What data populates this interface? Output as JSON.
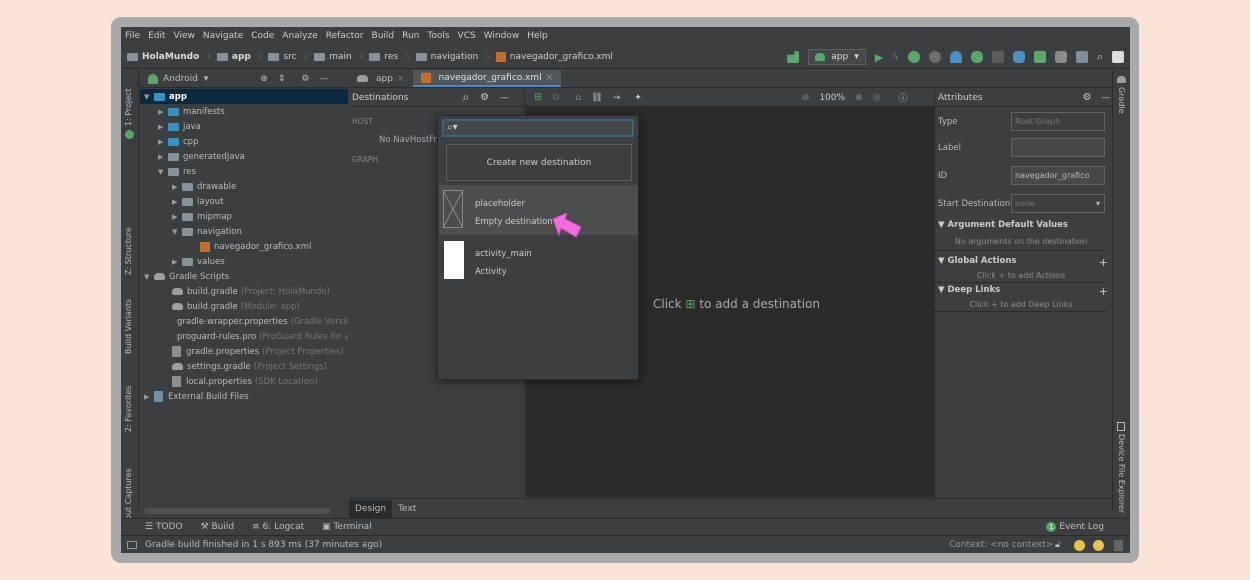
{
  "menu": [
    "File",
    "Edit",
    "View",
    "Navigate",
    "Code",
    "Analyze",
    "Refactor",
    "Build",
    "Run",
    "Tools",
    "VCS",
    "Window",
    "Help"
  ],
  "breadcrumb": [
    "HolaMundo",
    "app",
    "src",
    "main",
    "res",
    "navigation",
    "navegador_grafico.xml"
  ],
  "run_config": "app",
  "project_view": "Android",
  "tree": [
    {
      "label": "app",
      "note": ""
    },
    {
      "label": "manifests",
      "note": ""
    },
    {
      "label": "java",
      "note": ""
    },
    {
      "label": "cpp",
      "note": ""
    },
    {
      "label": "generatedJava",
      "note": ""
    },
    {
      "label": "res",
      "note": ""
    },
    {
      "label": "drawable",
      "note": ""
    },
    {
      "label": "layout",
      "note": ""
    },
    {
      "label": "mipmap",
      "note": ""
    },
    {
      "label": "navigation",
      "note": ""
    },
    {
      "label": "navegador_grafico.xml",
      "note": ""
    },
    {
      "label": "values",
      "note": ""
    },
    {
      "label": "Gradle Scripts",
      "note": ""
    },
    {
      "label": "build.gradle",
      "note": "(Project: HolaMundo)"
    },
    {
      "label": "build.gradle",
      "note": "(Module: app)"
    },
    {
      "label": "gradle-wrapper.properties",
      "note": "(Gradle Version"
    },
    {
      "label": "proguard-rules.pro",
      "note": "(ProGuard Rules for ap"
    },
    {
      "label": "gradle.properties",
      "note": "(Project Properties)"
    },
    {
      "label": "settings.gradle",
      "note": "(Project Settings)"
    },
    {
      "label": "local.properties",
      "note": "(SDK Location)"
    },
    {
      "label": "External Build Files",
      "note": ""
    }
  ],
  "left_strip": [
    "1: Project",
    "Z: Structure",
    "Build Variants",
    "2: Favorites",
    "Layout Captures"
  ],
  "right_strip": [
    "Gradle",
    "Device File Explorer"
  ],
  "tabs": [
    "app",
    "navegador_grafico.xml"
  ],
  "destinations": {
    "title": "Destinations",
    "host_label": "HOST",
    "host_value": "No NavHostFr",
    "graph_label": "GRAPH"
  },
  "popup": {
    "create_label": "Create new destination",
    "items": [
      {
        "name": "placeholder",
        "sub": "Empty destination"
      },
      {
        "name": "activity_main",
        "sub": "Activity"
      }
    ]
  },
  "zoom": "100%",
  "canvas": {
    "hint_before": "Click",
    "hint_after": "to add a destination"
  },
  "attributes": {
    "title": "Attributes",
    "type_label": "Type",
    "type_value": "Root Graph",
    "label_label": "Label",
    "label_value": "",
    "id_label": "ID",
    "id_value": "navegador_grafico",
    "start_label": "Start Destination",
    "start_value": "none",
    "arg_title": "Argument Default Values",
    "arg_sub": "No arguments on the destination",
    "actions_title": "Global Actions",
    "actions_sub": "Click + to add Actions",
    "links_title": "Deep Links",
    "links_sub": "Click + to add Deep Links"
  },
  "design_tabs": [
    "Design",
    "Text"
  ],
  "tool_windows": [
    "TODO",
    "Build",
    "6: Logcat",
    "Terminal"
  ],
  "event_log": "Event Log",
  "event_count": "1",
  "status_text": "Gradle build finished in 1 s 893 ms (37 minutes ago)",
  "context": "Context: <no context>",
  "colors": {
    "accent": "#4a88c7",
    "run_green": "#59a869",
    "pointer": "#f36be0"
  }
}
